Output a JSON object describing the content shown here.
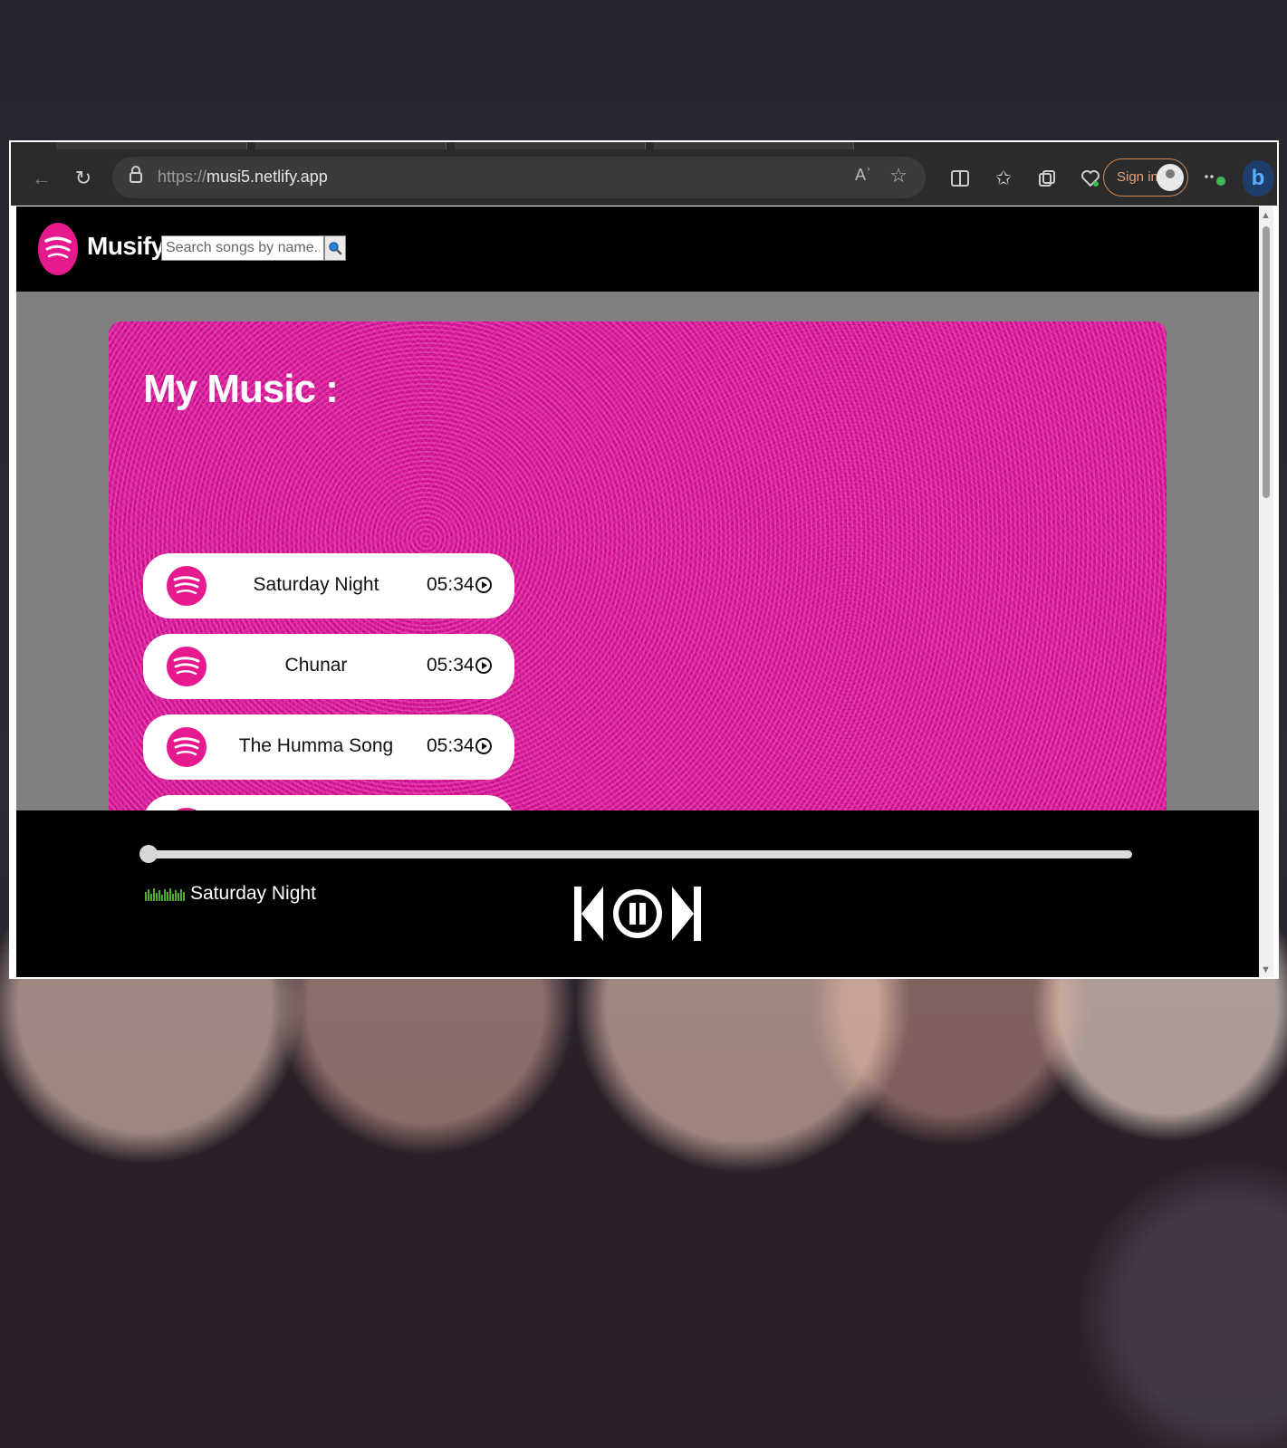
{
  "browser": {
    "url_protocol": "https://",
    "url_host": "musi5.netlify.app",
    "read_aloud": "Aʾ",
    "signin_label": "Sign in"
  },
  "app": {
    "brand": "Musify",
    "search_placeholder": "Search songs by name...",
    "heading": "My Music :"
  },
  "songs": [
    {
      "name": "Saturday Night",
      "duration": "05:34"
    },
    {
      "name": "Chunar",
      "duration": "05:34"
    },
    {
      "name": "The Humma Song",
      "duration": "05:34"
    }
  ],
  "player": {
    "now_playing": "Saturday Night",
    "progress": 0.02,
    "state": "playing"
  },
  "colors": {
    "accent": "#e6198e",
    "player_bg": "#000000"
  },
  "icons": [
    "back-icon",
    "refresh-icon",
    "lock-icon",
    "favorite-star-icon",
    "split-screen-icon",
    "favorites-icon",
    "collections-icon",
    "browser-essentials-icon",
    "more-icon",
    "bing-icon",
    "spotify-logo-icon",
    "search-icon",
    "play-circle-icon",
    "previous-icon",
    "pause-icon",
    "next-icon",
    "equalizer-icon"
  ]
}
